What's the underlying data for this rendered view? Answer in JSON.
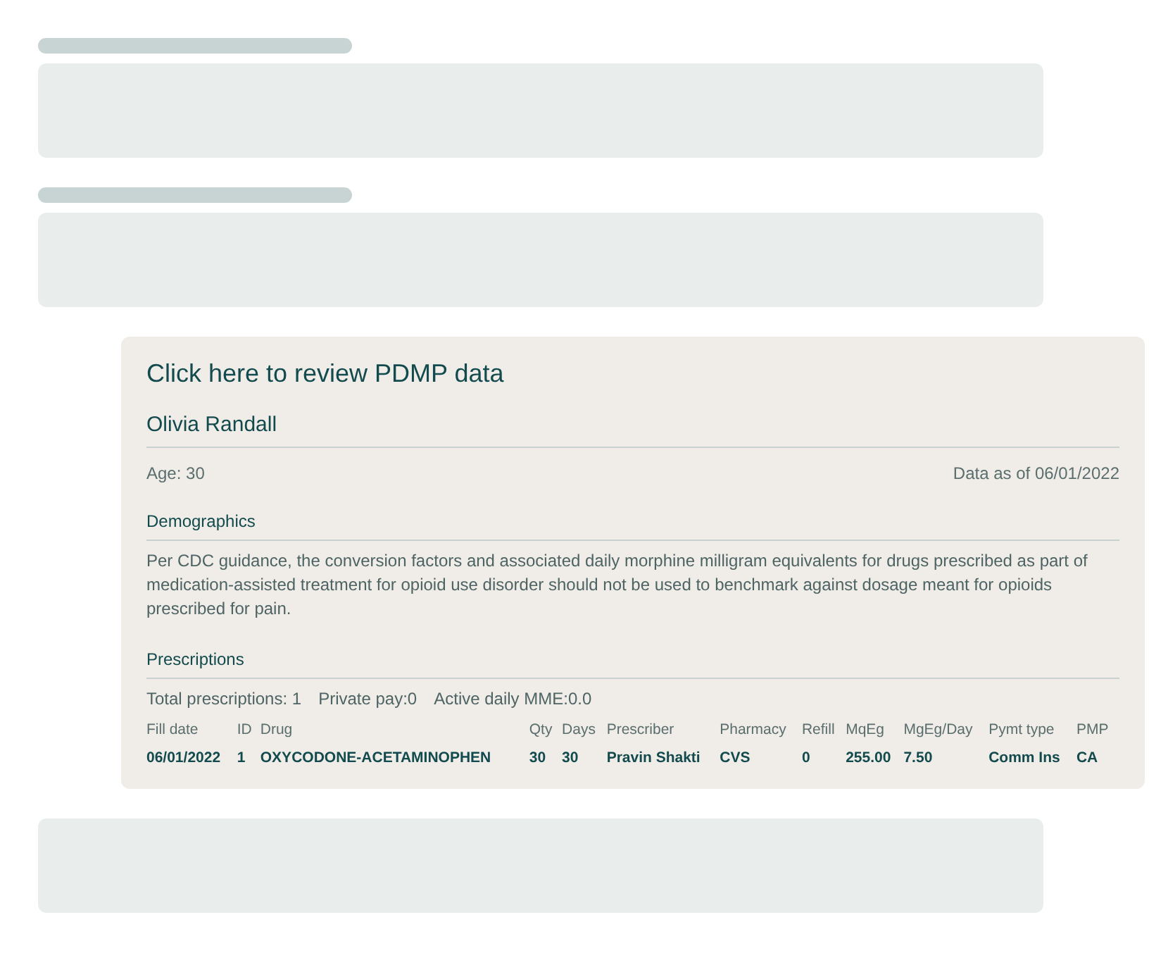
{
  "pdmp": {
    "link": "Click here to review PDMP data",
    "patient": "Olivia Randall",
    "age": "Age: 30",
    "data_as_of": "Data as of 06/01/2022",
    "demographics": {
      "heading": "Demographics",
      "note": "Per CDC guidance, the conversion factors and associated daily morphine milligram equivalents for drugs prescribed as part of medication-assisted treatment for opioid use disorder should not be used to benchmark against dosage meant for opioids prescribed for pain."
    },
    "prescriptions": {
      "heading": "Prescriptions",
      "summary": [
        "Total prescriptions: 1",
        "Private pay:0",
        "Active daily MME:0.0"
      ],
      "table": {
        "columns": [
          "Fill date",
          "ID",
          "Drug",
          "Qty",
          "Days",
          "Prescriber",
          "Pharmacy",
          "Refill",
          "MqEg",
          "MgEg/Day",
          "Pymt type",
          "PMP"
        ],
        "rows": [
          [
            "06/01/2022",
            "1",
            "OXYCODONE-ACETAMINOPHEN",
            "30",
            "30",
            "Pravin Shakti",
            "CVS",
            "0",
            "255.00",
            "7.50",
            "Comm Ins",
            "CA"
          ]
        ]
      }
    }
  }
}
